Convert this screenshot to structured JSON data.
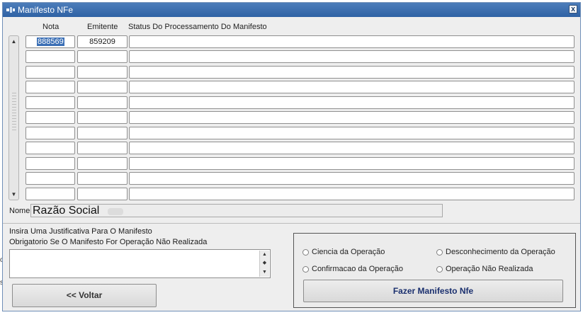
{
  "window": {
    "title": "Manifesto NFe",
    "close_label": "x"
  },
  "columns": {
    "nota": "Nota",
    "emitente": "Emitente",
    "status": "Status Do Processamento Do Manifesto"
  },
  "rows": [
    {
      "nota": "888569",
      "emitente": "859209",
      "status": ""
    },
    {
      "nota": "",
      "emitente": "",
      "status": ""
    },
    {
      "nota": "",
      "emitente": "",
      "status": ""
    },
    {
      "nota": "",
      "emitente": "",
      "status": ""
    },
    {
      "nota": "",
      "emitente": "",
      "status": ""
    },
    {
      "nota": "",
      "emitente": "",
      "status": ""
    },
    {
      "nota": "",
      "emitente": "",
      "status": ""
    },
    {
      "nota": "",
      "emitente": "",
      "status": ""
    },
    {
      "nota": "",
      "emitente": "",
      "status": ""
    },
    {
      "nota": "",
      "emitente": "",
      "status": ""
    },
    {
      "nota": "",
      "emitente": "",
      "status": ""
    }
  ],
  "nome": {
    "label": "Nome",
    "value": "Razão Social"
  },
  "justificativa": {
    "line1": "Insira Uma Justificativa Para O Manifesto",
    "line2": "Obrigatorio Se O Manifesto For Operação Não Realizada",
    "value": ""
  },
  "options": [
    {
      "label": "Ciencia da Operação"
    },
    {
      "label": "Desconhecimento da Operação"
    },
    {
      "label": "Confirmacao da Operação"
    },
    {
      "label": "Operação Não Realizada"
    }
  ],
  "buttons": {
    "voltar": "<< Voltar",
    "manifesto": "Fazer Manifesto Nfe"
  },
  "edge_chars": [
    "o",
    "s"
  ],
  "colors": {
    "titlebar": "#2f62a4",
    "selection": "#3b6fb5",
    "button_text": "#1a2f6e"
  }
}
